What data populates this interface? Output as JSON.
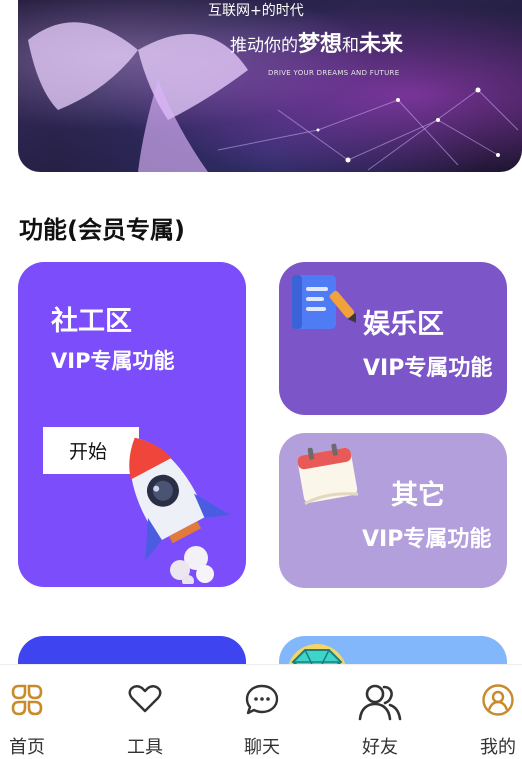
{
  "banner": {
    "line1": "互联网+的时代",
    "line2_prefix": "推动你的",
    "line2_bold1": "梦想",
    "line2_mid": "和",
    "line2_bold2": "未来",
    "line3": "DRIVE YOUR DREAMS AND FUTURE"
  },
  "section": {
    "title": "功能(会员专属)"
  },
  "cards": {
    "social": {
      "title": "社工区",
      "subtitle": "VIP专属功能",
      "button": "开始",
      "icon": "rocket-icon"
    },
    "entertainment": {
      "title": "娱乐区",
      "subtitle": "VIP专属功能",
      "icon": "notebook-pen-icon"
    },
    "other": {
      "title": "其它",
      "subtitle": "VIP专属功能",
      "icon": "calendar-icon"
    }
  },
  "peek": {
    "right_icon": "diamond-icon"
  },
  "tabbar": {
    "items": [
      {
        "label": "首页",
        "icon": "home-grid-icon",
        "active": true
      },
      {
        "label": "工具",
        "icon": "heart-icon"
      },
      {
        "label": "聊天",
        "icon": "chat-bubble-icon"
      },
      {
        "label": "好友",
        "icon": "friends-icon"
      },
      {
        "label": "我的",
        "icon": "profile-icon"
      }
    ]
  },
  "colors": {
    "accent": "#7b4dfb",
    "entertainment": "#7c56c8",
    "other": "#b39fdc",
    "peek_left": "#3d44f0",
    "peek_right": "#82b7fb",
    "tab_icon": "#c88a2a"
  }
}
